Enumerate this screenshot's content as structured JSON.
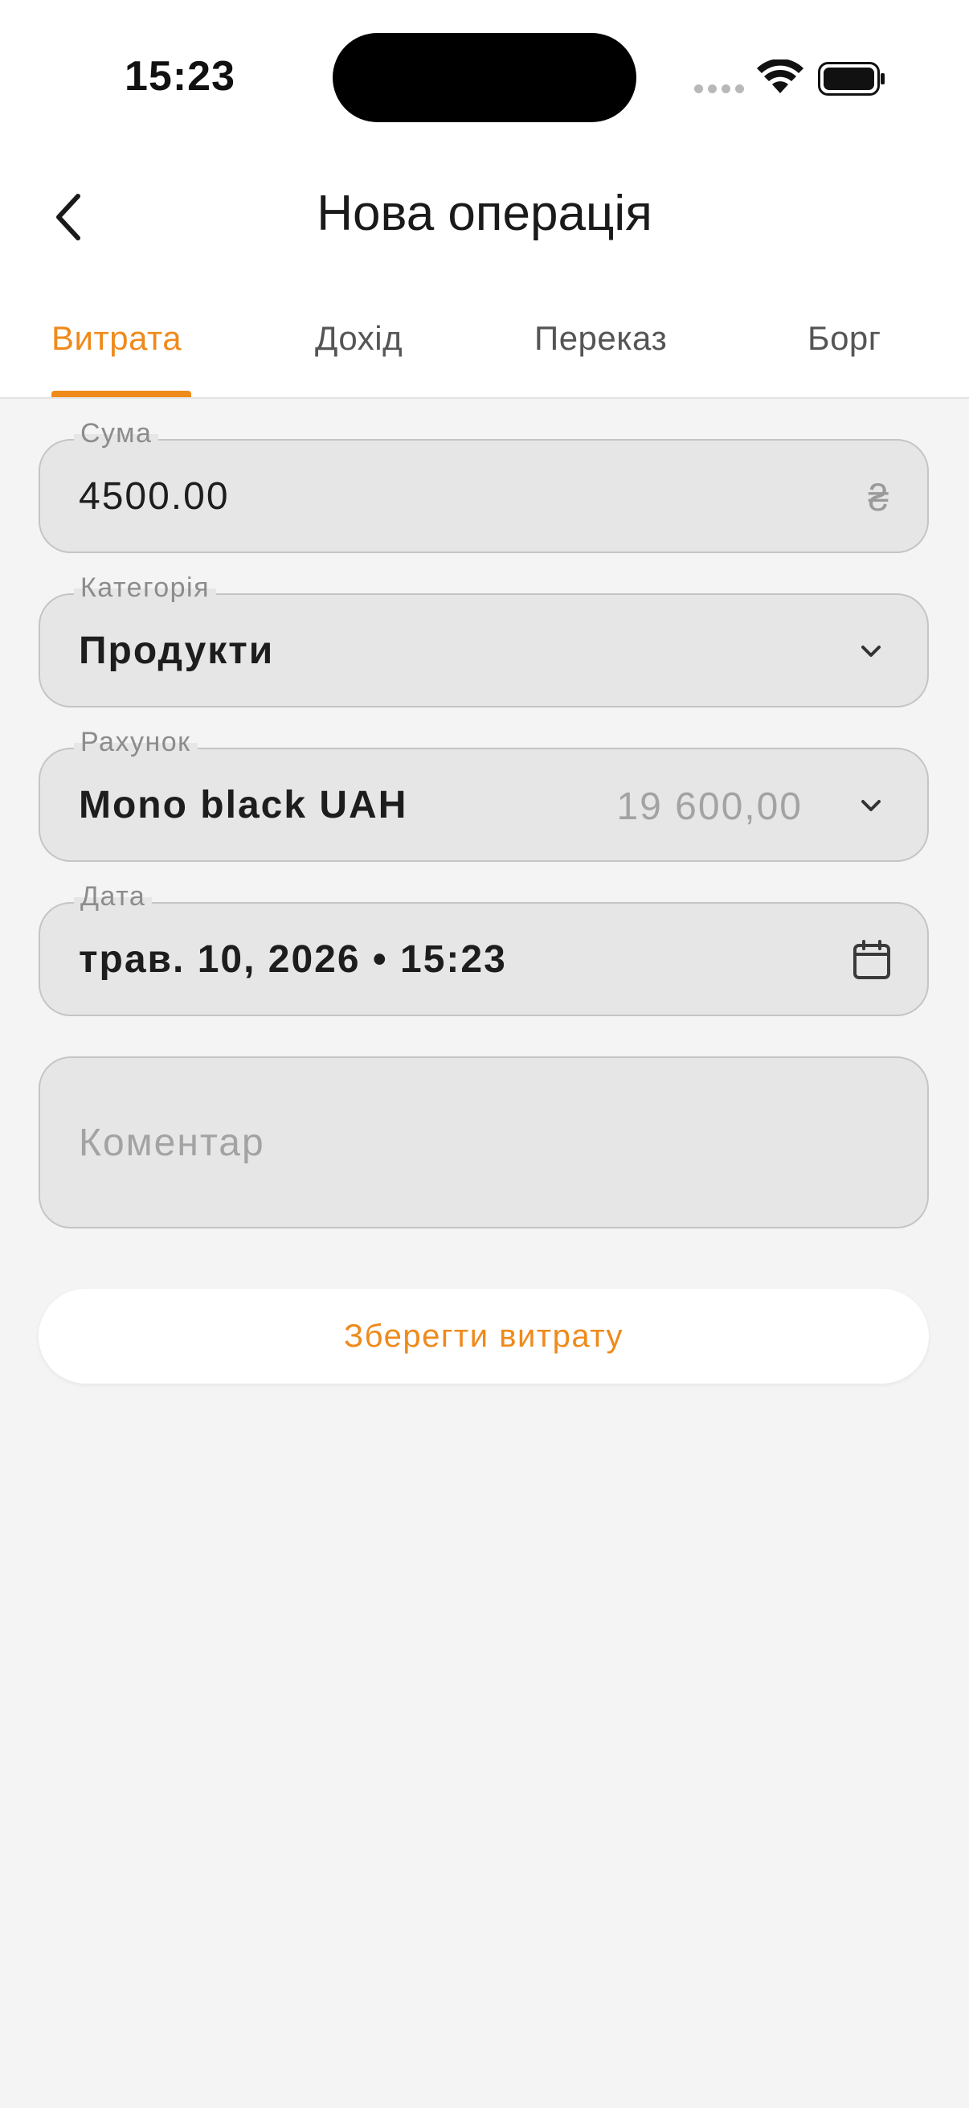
{
  "status_bar": {
    "time": "15:23"
  },
  "nav": {
    "title": "Нова операція"
  },
  "tabs": [
    {
      "label": "Витрата",
      "active": true
    },
    {
      "label": "Дохід",
      "active": false
    },
    {
      "label": "Переказ",
      "active": false
    },
    {
      "label": "Борг",
      "active": false
    }
  ],
  "form": {
    "amount": {
      "label": "Сума",
      "value": "4500.00",
      "currency_symbol": "₴"
    },
    "category": {
      "label": "Категорія",
      "value": "Продукти"
    },
    "account": {
      "label": "Рахунок",
      "value": "Mono black UAH",
      "balance": "19 600,00"
    },
    "date": {
      "label": "Дата",
      "value": "трав. 10, 2026 • 15:23"
    },
    "comment": {
      "placeholder": "Коментар"
    }
  },
  "save_button": {
    "label": "Зберегти витрату"
  },
  "colors": {
    "accent": "#ef8a1b",
    "field_background": "#e6e6e6",
    "page_background": "#f4f4f4"
  },
  "icons": [
    "wifi-icon",
    "battery-icon",
    "back-chevron-icon",
    "chevron-down-icon",
    "calendar-icon"
  ]
}
